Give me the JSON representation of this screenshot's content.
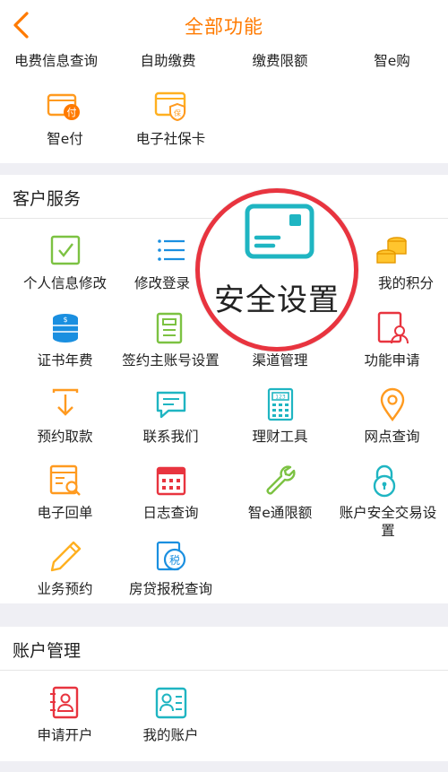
{
  "header": {
    "title": "全部功能"
  },
  "top_section": {
    "partial_labels": [
      "电费信息查询",
      "自助缴费",
      "缴费限额",
      "智e购"
    ],
    "items": [
      {
        "label": "智e付",
        "icon": "wallet-pay-icon"
      },
      {
        "label": "电子社保卡",
        "icon": "social-security-card-icon"
      }
    ]
  },
  "customer_service": {
    "title": "客户服务",
    "items": [
      {
        "label": "个人信息修改",
        "icon": "checkbox-icon"
      },
      {
        "label": "修改登录",
        "icon": "list-icon"
      },
      {
        "label": "安全设置",
        "icon": "card-icon"
      },
      {
        "label": "我的积分",
        "icon": "coins-icon"
      },
      {
        "label": "证书年费",
        "icon": "coin-stack-icon"
      },
      {
        "label": "签约主账号设置",
        "icon": "document-icon"
      },
      {
        "label": "渠道管理",
        "icon": "channel-icon"
      },
      {
        "label": "功能申请",
        "icon": "apply-user-icon"
      },
      {
        "label": "预约取款",
        "icon": "download-box-icon"
      },
      {
        "label": "联系我们",
        "icon": "chat-bubble-icon"
      },
      {
        "label": "理财工具",
        "icon": "calculator-icon"
      },
      {
        "label": "网点查询",
        "icon": "location-pin-icon"
      },
      {
        "label": "电子回单",
        "icon": "receipt-search-icon"
      },
      {
        "label": "日志查询",
        "icon": "calendar-icon"
      },
      {
        "label": "智e通限额",
        "icon": "wrench-icon"
      },
      {
        "label_line1": "账户安全交易设",
        "label_line2": "置",
        "icon": "lock-icon"
      },
      {
        "label": "业务预约",
        "icon": "pencil-icon"
      },
      {
        "label": "房贷报税查询",
        "icon": "tax-icon"
      }
    ]
  },
  "magnifier": {
    "label": "安全设置",
    "icon": "card-icon"
  },
  "account_management": {
    "title": "账户管理",
    "items": [
      {
        "label": "申请开户",
        "icon": "open-account-icon"
      },
      {
        "label": "我的账户",
        "icon": "my-account-icon"
      }
    ]
  },
  "colors": {
    "accent": "#ff7a00",
    "teal": "#1fb5c2",
    "green": "#7cc242",
    "red": "#e8343f",
    "blue": "#1a8fe0"
  }
}
